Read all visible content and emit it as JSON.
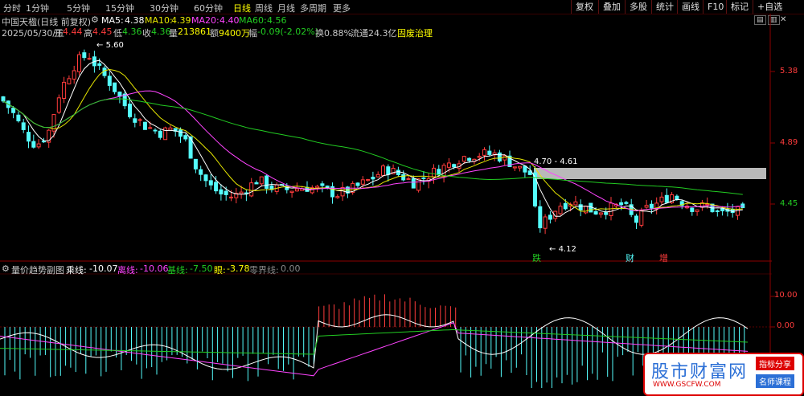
{
  "periods": [
    "分时",
    "1分钟",
    "5分钟",
    "15分钟",
    "30分钟",
    "60分钟",
    "日线",
    "周线",
    "月线",
    "多周期",
    "更多"
  ],
  "active_period": "日线",
  "right_buttons": [
    "复权",
    "叠加",
    "多股",
    "统计",
    "画线",
    "F10",
    "标记",
    "+自选"
  ],
  "stock": {
    "title": "中国天楹(日线 前复权)",
    "date": "2025/05/30/五",
    "open_label": "开",
    "open": "4.44",
    "high_label": "高",
    "high": "4.45",
    "low_label": "低",
    "low": "4.36",
    "close_label": "收",
    "close": "4.36",
    "vol_label": "量",
    "volume": "213861",
    "amt_label": "额",
    "amount": "9400万",
    "chg_label": "幅",
    "change": "-0.09(-2.02%)",
    "turnover": "换0.88%",
    "float_cap": "流通24.3亿",
    "concept": "固废治理"
  },
  "ma": [
    {
      "label": "MA5:",
      "value": "4.38",
      "color": "#ffffff"
    },
    {
      "label": "MA10:",
      "value": "4.39",
      "color": "#e6e600"
    },
    {
      "label": "MA20:",
      "value": "4.40",
      "color": "#ff44ff"
    },
    {
      "label": "MA60:",
      "value": "4.56",
      "color": "#22cc22"
    }
  ],
  "price_axis": [
    "5.38",
    "4.89",
    "4.45"
  ],
  "annotations": {
    "high": "5.60",
    "low": "4.12",
    "range": "4.70 - 4.61",
    "signals": [
      "跌",
      "财",
      "增"
    ]
  },
  "indicator": {
    "title": "量价趋势副图",
    "items": [
      {
        "label": "乘线:",
        "value": "-10.07",
        "color": "#ffffff"
      },
      {
        "label": "离线:",
        "value": "-10.06",
        "color": "#ff44ff"
      },
      {
        "label": "基线:",
        "value": "-7.50",
        "color": "#22cc22"
      },
      {
        "label": "眼:",
        "value": "-3.78",
        "color": "#ffff00"
      },
      {
        "label": "零界线:",
        "value": "0.00",
        "color": "#888888"
      }
    ],
    "axis": [
      "10.00",
      "0.00"
    ]
  },
  "watermark": {
    "title": "股市财富网",
    "url": "WWW.GSCFW.COM",
    "badge1": "指标分享",
    "badge2": "名师课程"
  },
  "colors": {
    "up": "#ff3c3c",
    "down": "#54fcfc",
    "ma5": "#ffffff",
    "ma10": "#e6e600",
    "ma20": "#ff44ff",
    "ma60": "#22cc22"
  }
}
